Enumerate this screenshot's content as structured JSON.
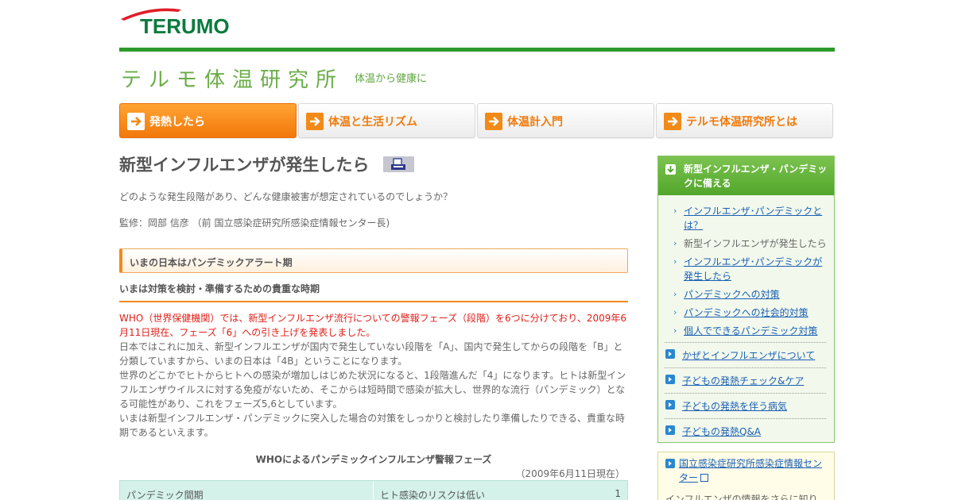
{
  "brand": {
    "logo_text": "TERUMO",
    "color": "#0b7a3e",
    "swoosh_color": "#e01e28"
  },
  "site": {
    "title": "テルモ体温研究所",
    "subtitle": "体温から健康に"
  },
  "nav": {
    "tabs": [
      {
        "label": "発熱したら",
        "active": true
      },
      {
        "label": "体温と生活リズム",
        "active": false
      },
      {
        "label": "体温計入門",
        "active": false
      },
      {
        "label": "テルモ体温研究所とは",
        "active": false
      }
    ]
  },
  "main": {
    "title": "新型インフルエンザが発生したら",
    "lead": "どのような発生段階があり、どんな健康被害が想定されているのでしょうか？",
    "supervisor": "監修：岡部 信彦 （前 国立感染症研究所感染症情報センター長)",
    "section_heading": "いまの日本はパンデミックアラート期",
    "sub_heading": "いまは対策を検討・準備するための貴重な時期",
    "highlight": "WHO（世界保健機関）では、新型インフルエンザ流行についての警報フェーズ（段階）を6つに分けており、2009年6月11日現在、フェーズ「6」への引き上げを発表しました。",
    "paragraphs": [
      "日本ではこれに加え、新型インフルエンザが国内で発生していない段階を「A」、国内で発生してからの段階を「B」と分類していますから、いまの日本は「4B」ということになります。",
      "世界のどこかでヒトからヒトへの感染が増加しはじめた状況になると、1段階進んだ「4」になります。ヒトは新型インフルエンザウイルスに対する免疫がないため、そこからは短時間で感染が拡大し、世界的な流行（パンデミック）となる可能性があり、これをフェーズ5,6としています。",
      "いまは新型インフルエンザ・パンデミックに突入した場合の対策をしっかりと検討したり準備したりできる、貴重な時期であるといえます。"
    ],
    "table": {
      "caption": "WHOによるパンデミックインフルエンザ警報フェーズ",
      "date": "（2009年6月11日現在）",
      "rows": [
        {
          "period": "パンデミック間期",
          "description": "ヒト感染のリスクは低い",
          "phase": "1"
        }
      ]
    }
  },
  "sidebar": {
    "heading": "新型インフルエンザ・パンデミックに備える",
    "sub_items": [
      {
        "label": "インフルエンザ･パンデミックとは？",
        "current": false
      },
      {
        "label": "新型インフルエンザが発生したら",
        "current": true
      },
      {
        "label": "インフルエンザ･パンデミックが発生したら",
        "current": false
      },
      {
        "label": "パンデミックへの対策",
        "current": false
      },
      {
        "label": "パンデミックへの社会的対策",
        "current": false
      },
      {
        "label": "個人でできるパンデミック対策",
        "current": false
      }
    ],
    "main_items": [
      {
        "label": "かぜとインフルエンザについて"
      },
      {
        "label": "子どもの発熱チェック&ケア"
      },
      {
        "label": "子どもの発熱を伴う病気"
      },
      {
        "label": "子どもの発熱Q&A"
      }
    ],
    "external_link": "国立感染症研究所感染症情報センター",
    "external_desc": "インフルエンザの情報をさらに知り"
  },
  "colors": {
    "accent_orange": "#f28a17",
    "green": "#2e9a2c",
    "link_blue": "#1b5fb4",
    "alert_red": "#e0201a"
  }
}
